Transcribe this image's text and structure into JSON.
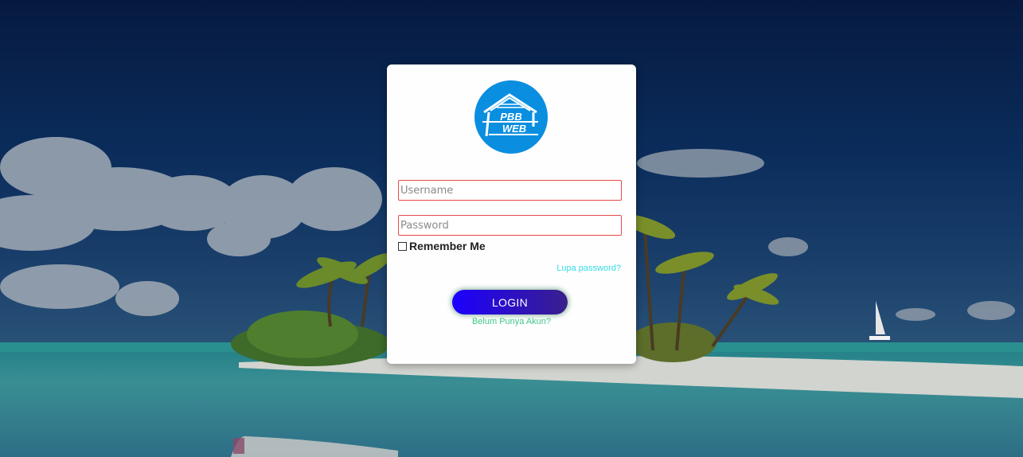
{
  "logo": {
    "line1": "PBB",
    "line2": "WEB",
    "color": "#0a8ee0"
  },
  "form": {
    "username_placeholder": "Username",
    "password_placeholder": "Password",
    "remember_label": "Remember Me",
    "forgot_label": "Lupa password?",
    "login_label": "LOGIN",
    "signup_label": "Belum Punya Akun?"
  },
  "colors": {
    "field_border": "#e84a4a",
    "forgot": "#33dfe6",
    "signup": "#3fc98a",
    "login_start": "#1c00ff",
    "login_end": "#3a1f8c"
  }
}
